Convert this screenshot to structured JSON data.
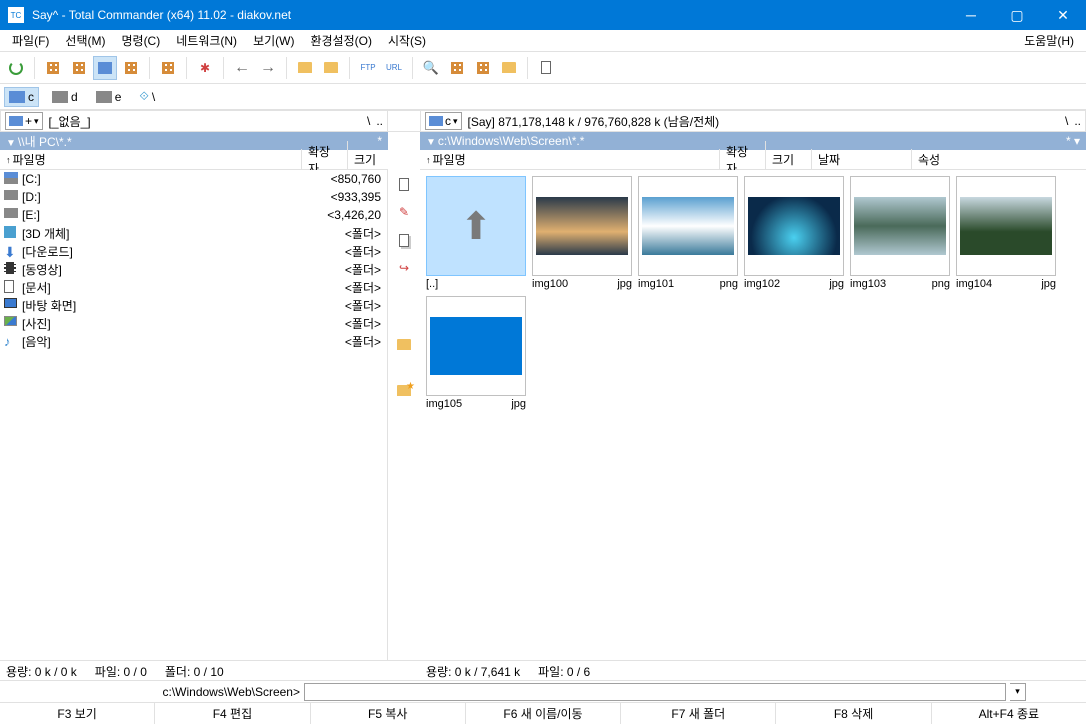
{
  "titlebar": {
    "icon_text": "TC",
    "text": "Say^ - Total Commander (x64) 11.02 - diakov.net"
  },
  "menu": {
    "items": [
      "파일(F)",
      "선택(M)",
      "명령(C)",
      "네트워크(N)",
      "보기(W)",
      "환경설정(O)",
      "시작(S)"
    ],
    "help": "도움말(H)"
  },
  "drivebar": {
    "drives": [
      {
        "label": "c",
        "active": true,
        "blue": true
      },
      {
        "label": "d",
        "active": false,
        "blue": false
      },
      {
        "label": "e",
        "active": false,
        "blue": false
      }
    ],
    "net": "\\"
  },
  "left_header": {
    "drive_select": "+",
    "label": "[_없음_]",
    "nav1": "\\",
    "nav2": ".."
  },
  "right_header": {
    "drive_select": "c",
    "info": "[Say]  871,178,148 k / 976,760,828 k (남음/전체)",
    "nav1": "\\",
    "nav2": ".."
  },
  "left_path": {
    "text": "\\\\내 PC\\*.*",
    "star": "*"
  },
  "right_path": {
    "text": "c:\\Windows\\Web\\Screen\\*.*",
    "star": "*  ▾"
  },
  "left_cols": {
    "name": "파일명",
    "ext": "확장자",
    "size": "크기"
  },
  "right_cols": {
    "name": "파일명",
    "ext": "확장자",
    "size": "크기",
    "date": "날짜",
    "attr": "속성"
  },
  "left_files": [
    {
      "icon": "hdd-c",
      "name": "[C:]",
      "size": "<850,760"
    },
    {
      "icon": "hdd",
      "name": "[D:]",
      "size": "<933,395"
    },
    {
      "icon": "hdd",
      "name": "[E:]",
      "size": "<3,426,20"
    },
    {
      "icon": "cube",
      "name": "[3D 개체]",
      "size": "<폴더>"
    },
    {
      "icon": "down",
      "name": "[다운로드]",
      "size": "<폴더>"
    },
    {
      "icon": "film",
      "name": "[동영상]",
      "size": "<폴더>"
    },
    {
      "icon": "doc",
      "name": "[문서]",
      "size": "<폴더>"
    },
    {
      "icon": "monitor",
      "name": "[바탕 화면]",
      "size": "<폴더>"
    },
    {
      "icon": "photo",
      "name": "[사진]",
      "size": "<폴더>"
    },
    {
      "icon": "note",
      "name": "[음악]",
      "size": "<폴더>"
    }
  ],
  "thumbs": [
    {
      "name": "[..]",
      "ext": "",
      "up": true,
      "selected": true
    },
    {
      "name": "img100",
      "ext": "jpg",
      "bg": "linear-gradient(#2a3a4a,#e0b070 60%,#2a3a4a)"
    },
    {
      "name": "img101",
      "ext": "png",
      "bg": "linear-gradient(#5aa0d0,#fff 50%,#3a7a9a)"
    },
    {
      "name": "img102",
      "ext": "jpg",
      "bg": "radial-gradient(circle at 50% 70%,#4ad0f0,#0a2a4a 70%)"
    },
    {
      "name": "img103",
      "ext": "png",
      "bg": "linear-gradient(#b0c8d0,#4a6a5a 50%,#b0c8d0)"
    },
    {
      "name": "img104",
      "ext": "jpg",
      "bg": "linear-gradient(#c8d8e0,#2a4a2a 60%)"
    },
    {
      "name": "img105",
      "ext": "jpg",
      "solid": "#0078d7"
    }
  ],
  "left_status": {
    "cap": "용량: 0 k / 0 k",
    "files": "파일: 0 / 0",
    "folders": "폴더: 0 / 10"
  },
  "right_status": {
    "cap": "용량: 0 k / 7,641 k",
    "files": "파일: 0 / 6"
  },
  "cmdline": {
    "path": "c:\\Windows\\Web\\Screen>"
  },
  "fkeys": [
    "F3 보기",
    "F4 편집",
    "F5 복사",
    "F6 새 이름/이동",
    "F7 새 폴더",
    "F8 삭제",
    "Alt+F4 종료"
  ]
}
